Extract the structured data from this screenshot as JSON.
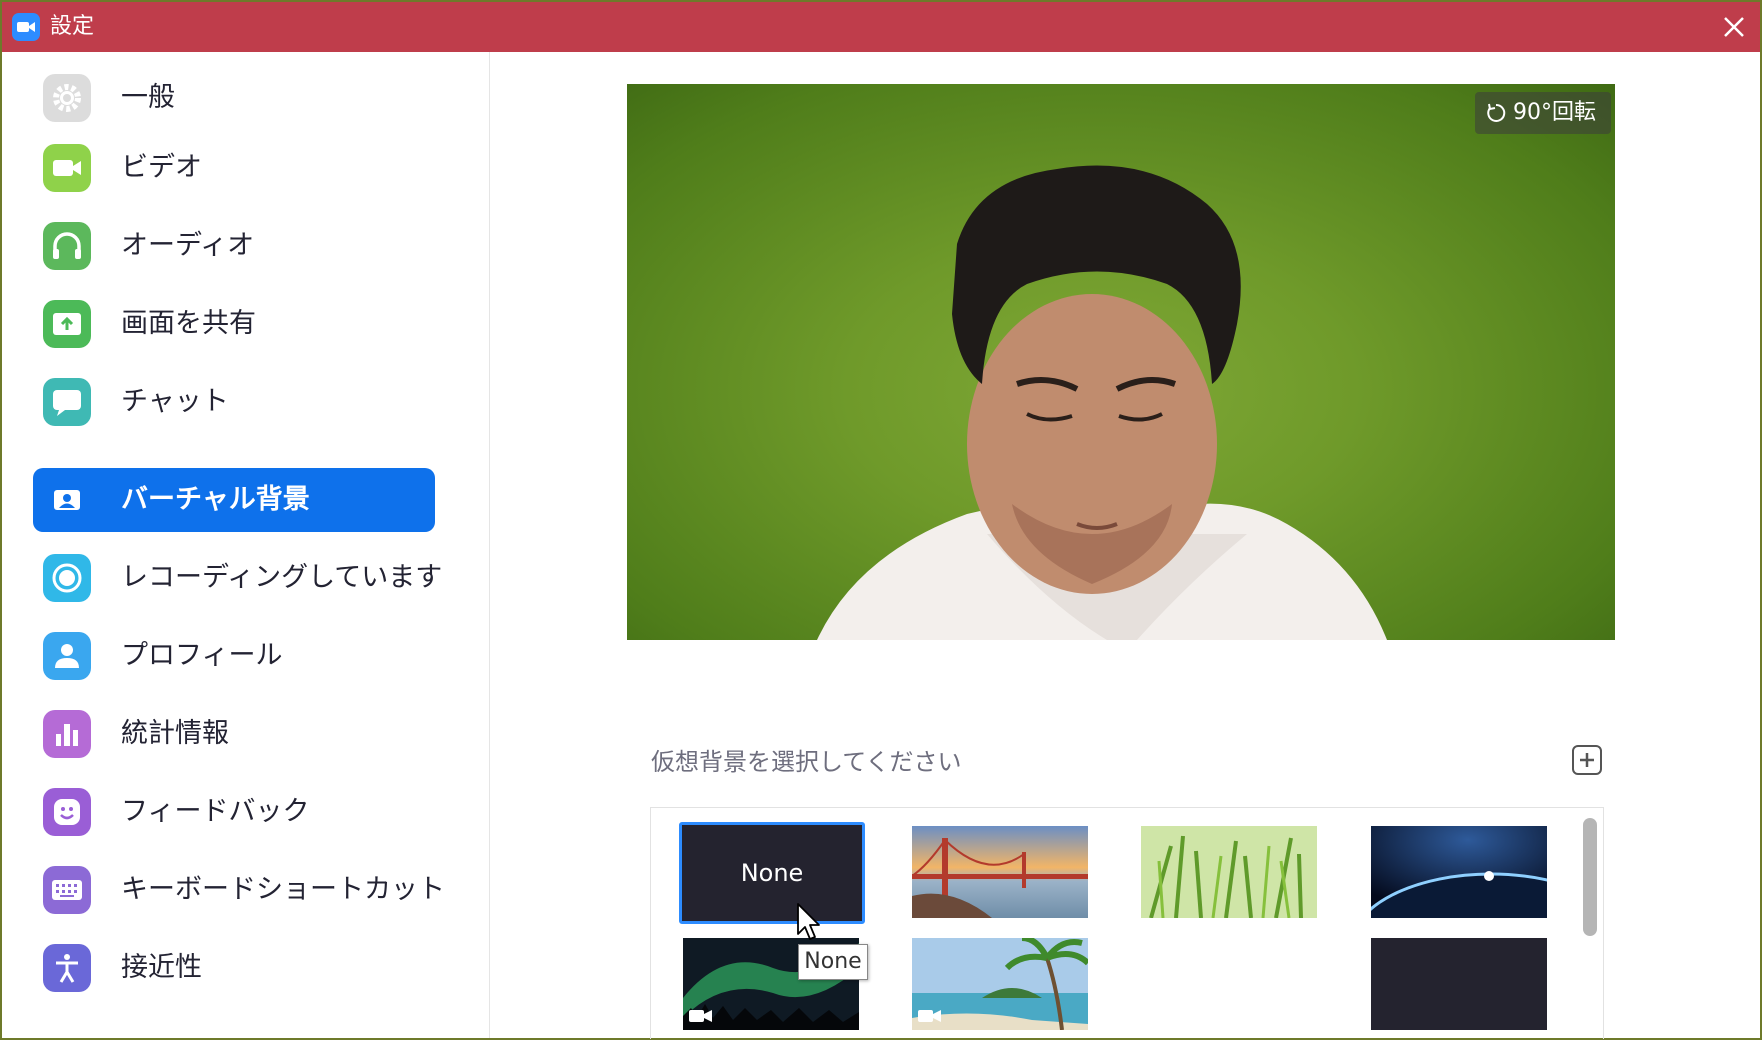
{
  "window": {
    "title": "設定"
  },
  "sidebar": {
    "items": [
      {
        "label": "一般",
        "icon": "gear-icon",
        "color": "#dcdcdc"
      },
      {
        "label": "ビデオ",
        "icon": "video-camera-icon",
        "color": "#8fd24a"
      },
      {
        "label": "オーディオ",
        "icon": "headphones-icon",
        "color": "#5cb85c"
      },
      {
        "label": "画面を共有",
        "icon": "share-screen-icon",
        "color": "#4cba58"
      },
      {
        "label": "チャット",
        "icon": "chat-bubble-icon",
        "color": "#3fb9b4"
      },
      {
        "label": "バーチャル背景",
        "icon": "virtual-background-icon",
        "color": "#0e71eb",
        "active": true
      },
      {
        "label": "レコーディングしています",
        "icon": "record-icon",
        "color": "#30b8e8"
      },
      {
        "label": "プロフィール",
        "icon": "person-icon",
        "color": "#3aa7ef"
      },
      {
        "label": "統計情報",
        "icon": "bar-chart-icon",
        "color": "#b56bd6"
      },
      {
        "label": "フィードバック",
        "icon": "smiley-icon",
        "color": "#9a5ed6"
      },
      {
        "label": "キーボードショートカット",
        "icon": "keyboard-icon",
        "color": "#8c6ad6"
      },
      {
        "label": "接近性",
        "icon": "accessibility-icon",
        "color": "#6a68d8"
      }
    ]
  },
  "preview": {
    "rotate_label": "90°回転"
  },
  "backgrounds": {
    "title": "仮想背景を選択してください",
    "items": [
      {
        "name": "none",
        "label": "None",
        "selected": true
      },
      {
        "name": "golden-gate-bridge"
      },
      {
        "name": "grass"
      },
      {
        "name": "earth-from-space"
      },
      {
        "name": "aurora",
        "video": true
      },
      {
        "name": "beach-palm",
        "video": true
      },
      {
        "name": "empty"
      },
      {
        "name": "dark"
      }
    ],
    "tooltip": "None"
  },
  "colors": {
    "titlebar": "#bf3d4b",
    "accent": "#0e71eb"
  }
}
